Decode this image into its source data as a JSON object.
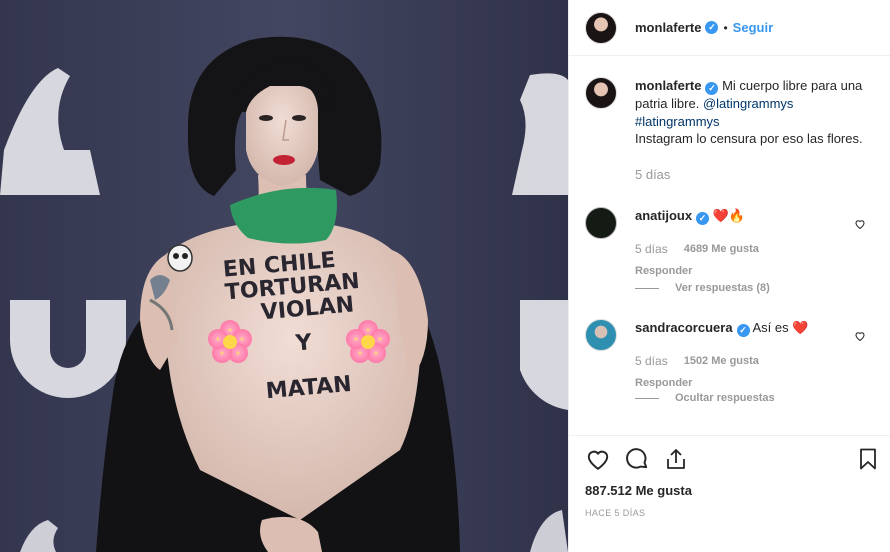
{
  "photo": {
    "bodypaint_lines": [
      "EN CHILE",
      "TORTURAN",
      "VIOLAN",
      "Y",
      "MATAN"
    ]
  },
  "post": {
    "username": "monlaferte",
    "verified_mark": "✓",
    "separator": "•",
    "follow_label": "Seguir"
  },
  "caption": {
    "username": "monlaferte",
    "text_part1": "Mi cuerpo libre para una patria libre.",
    "mention": "@latingrammys",
    "hashtag": "#latingrammys",
    "text_part2": "Instagram lo censura por eso las flores.",
    "time": "5 días"
  },
  "comments": [
    {
      "username": "anatijoux",
      "text": "",
      "emoji": "❤️🔥",
      "time": "5 días",
      "likes": "4689 Me gusta",
      "reply_label": "Responder",
      "replies_toggle": "Ver respuestas (8)"
    },
    {
      "username": "sandracorcuera",
      "text": "Así es",
      "emoji": "❤️",
      "time": "5 días",
      "likes": "1502 Me gusta",
      "reply_label": "Responder",
      "replies_toggle": "Ocultar respuestas"
    }
  ],
  "footer": {
    "likes": "887.512 Me gusta",
    "timestamp": "HACE 5 DÍAS"
  },
  "colors": {
    "accent": "#3897f0",
    "heart_red": "#ed4956",
    "muted": "#999999",
    "mention": "#003569"
  },
  "icons": [
    "heart-icon",
    "comment-icon",
    "share-icon",
    "bookmark-icon",
    "verified-badge-icon"
  ]
}
